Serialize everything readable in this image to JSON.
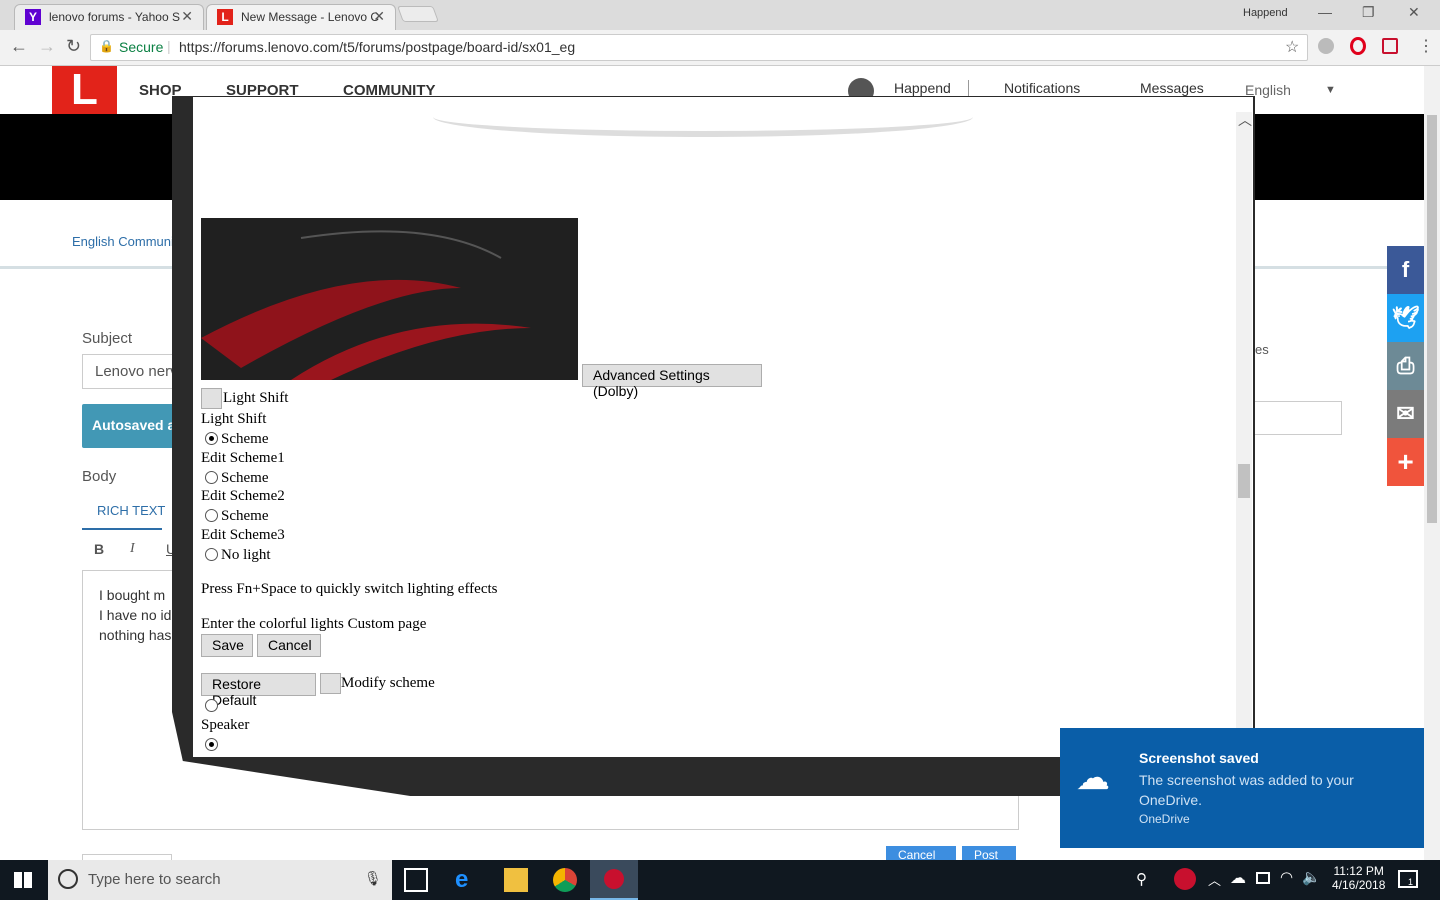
{
  "browser": {
    "tabs": [
      {
        "title": "lenovo forums - Yahoo S",
        "favicon": "Y"
      },
      {
        "title": "New Message - Lenovo C",
        "favicon": "L"
      }
    ],
    "profile_name": "Happend",
    "secure_label": "Secure",
    "url": "https://forums.lenovo.com/t5/forums/postpage/board-id/sx01_eg"
  },
  "site": {
    "logo_letter": "L",
    "nav": [
      "SHOP",
      "SUPPORT",
      "COMMUNITY"
    ],
    "user": "Happend",
    "notifications": "Notifications",
    "messages": "Messages",
    "language": "English",
    "breadcrumb": "English Communit",
    "subject_label": "Subject",
    "subject_value": "Lenovo nerv",
    "autosaved": "Autosaved a",
    "body_label": "Body",
    "rich_text_tab": "RICH TEXT",
    "body_lines": [
      "I bought m",
      "I have no id",
      "nothing has"
    ],
    "right_label": "es",
    "cancel_btn": "Cancel",
    "post_btn": "Post"
  },
  "dialog": {
    "advanced_btn": "Advanced Settings (Dolby)",
    "light_shift_chk": "Light Shift",
    "light_shift_heading": "Light Shift",
    "scheme_radio": "Scheme",
    "edit_scheme1": "Edit Scheme1",
    "edit_scheme2": "Edit Scheme2",
    "edit_scheme3": "Edit Scheme3",
    "no_light": "No light",
    "hint": "Press Fn+Space to quickly switch lighting effects",
    "enter_custom": "Enter the colorful lights Custom page",
    "save_btn": "Save",
    "cancel_btn": "Cancel",
    "restore_btn": "Restore Default",
    "modify_chk": "Modify scheme",
    "speaker": "Speaker"
  },
  "toast": {
    "title": "Screenshot saved",
    "body": "The screenshot was added to your OneDrive.",
    "source": "OneDrive"
  },
  "taskbar": {
    "search_placeholder": "Type here to search",
    "time": "11:12 PM",
    "date": "4/16/2018",
    "notification_count": "1"
  },
  "colors": {
    "lenovo_red": "#e2231a",
    "facebook": "#3b5998",
    "twitter": "#1da1f2",
    "print": "#6d8a96",
    "email": "#7b7b7b",
    "more": "#f0543c",
    "toast": "#0a5ea8"
  }
}
